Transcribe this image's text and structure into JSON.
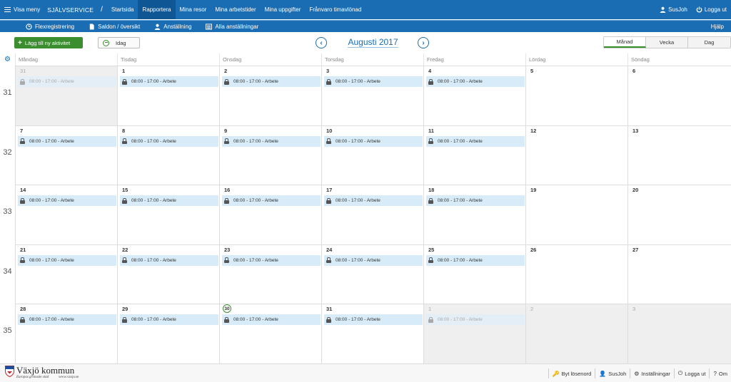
{
  "topnav": {
    "menu_label": "Visa meny",
    "brand": "SJÄLVSERVICE",
    "separator": "/",
    "items": [
      "Startsida",
      "Rapportera",
      "Mina resor",
      "Mina arbetstider",
      "Mina uppgifter",
      "Frånvaro timavlönad"
    ],
    "active_index": 1,
    "user": "SusJoh",
    "logout": "Logga ut"
  },
  "subnav": {
    "items": [
      {
        "label": "Flexregistrering",
        "icon": "clock-icon"
      },
      {
        "label": "Saldon / översikt",
        "icon": "document-icon"
      },
      {
        "label": "Anställning",
        "icon": "person-icon"
      },
      {
        "label": "Alla anställningar",
        "icon": "list-icon"
      }
    ],
    "help": "Hjälp"
  },
  "toolbar": {
    "add_label": "Lägg till ny aktivitet",
    "today_label": "Idag",
    "month_title": "Augusti 2017",
    "views": [
      "Månad",
      "Vecka",
      "Dag"
    ],
    "active_view": 0
  },
  "calendar": {
    "weekdays": [
      "Måndag",
      "Tisdag",
      "Onsdag",
      "Torsdag",
      "Fredag",
      "Lördag",
      "Söndag"
    ],
    "event_label": "08:00 - 17:00 - Arbete",
    "today": "30",
    "weeks": [
      {
        "week": "31",
        "days": [
          {
            "d": "31",
            "other": true,
            "event": true
          },
          {
            "d": "1",
            "other": false,
            "event": true
          },
          {
            "d": "2",
            "other": false,
            "event": true
          },
          {
            "d": "3",
            "other": false,
            "event": true
          },
          {
            "d": "4",
            "other": false,
            "event": true
          },
          {
            "d": "5",
            "other": false,
            "event": false
          },
          {
            "d": "6",
            "other": false,
            "event": false
          }
        ]
      },
      {
        "week": "32",
        "days": [
          {
            "d": "7",
            "other": false,
            "event": true
          },
          {
            "d": "8",
            "other": false,
            "event": true
          },
          {
            "d": "9",
            "other": false,
            "event": true
          },
          {
            "d": "10",
            "other": false,
            "event": true
          },
          {
            "d": "11",
            "other": false,
            "event": true
          },
          {
            "d": "12",
            "other": false,
            "event": false
          },
          {
            "d": "13",
            "other": false,
            "event": false
          }
        ]
      },
      {
        "week": "33",
        "days": [
          {
            "d": "14",
            "other": false,
            "event": true
          },
          {
            "d": "15",
            "other": false,
            "event": true
          },
          {
            "d": "16",
            "other": false,
            "event": true
          },
          {
            "d": "17",
            "other": false,
            "event": true
          },
          {
            "d": "18",
            "other": false,
            "event": true
          },
          {
            "d": "19",
            "other": false,
            "event": false
          },
          {
            "d": "20",
            "other": false,
            "event": false
          }
        ]
      },
      {
        "week": "34",
        "days": [
          {
            "d": "21",
            "other": false,
            "event": true
          },
          {
            "d": "22",
            "other": false,
            "event": true
          },
          {
            "d": "23",
            "other": false,
            "event": true
          },
          {
            "d": "24",
            "other": false,
            "event": true
          },
          {
            "d": "25",
            "other": false,
            "event": true
          },
          {
            "d": "26",
            "other": false,
            "event": false
          },
          {
            "d": "27",
            "other": false,
            "event": false
          }
        ]
      },
      {
        "week": "35",
        "days": [
          {
            "d": "28",
            "other": false,
            "event": true
          },
          {
            "d": "29",
            "other": false,
            "event": true
          },
          {
            "d": "30",
            "other": false,
            "event": true
          },
          {
            "d": "31",
            "other": false,
            "event": true
          },
          {
            "d": "1",
            "other": true,
            "event": true
          },
          {
            "d": "2",
            "other": true,
            "event": false
          },
          {
            "d": "3",
            "other": true,
            "event": false
          }
        ]
      }
    ]
  },
  "footer": {
    "logo_name": "Växjö kommun",
    "logo_tagline": "Europas grönaste stad",
    "logo_url": "www.vaxjo.se",
    "links": [
      {
        "label": "Byt lösenord",
        "icon": "key-icon"
      },
      {
        "label": "SusJoh",
        "icon": "person-icon"
      },
      {
        "label": "Inställningar",
        "icon": "gear-icon"
      },
      {
        "label": "Logga ut",
        "icon": "power-icon"
      },
      {
        "label": "Om",
        "icon": "question-icon"
      }
    ]
  },
  "colors": {
    "primary": "#1a6db3",
    "accent_green": "#3a8e2e",
    "event_bg": "#d7ecf8"
  }
}
